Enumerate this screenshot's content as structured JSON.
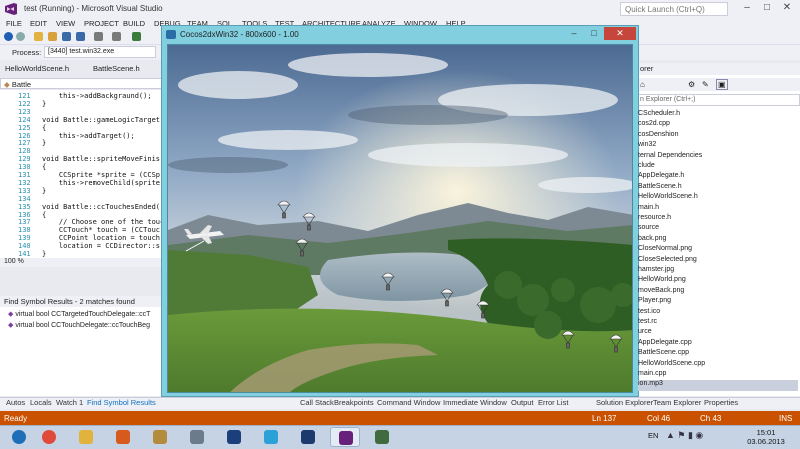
{
  "window": {
    "title": "test (Running) - Microsoft Visual Studio",
    "quick_launch": "Quick Launch (Ctrl+Q)",
    "minimize": "–",
    "maximize": "□",
    "close": "✕"
  },
  "menu": [
    "FILE",
    "EDIT",
    "VIEW",
    "PROJECT",
    "BUILD",
    "DEBUG",
    "TEAM",
    "SQL",
    "TOOLS",
    "TEST",
    "ARCHITECTURE",
    "ANALYZE",
    "WINDOW",
    "HELP"
  ],
  "process": {
    "label": "Process:",
    "value": "[3440] test.win32.exe"
  },
  "doc_tabs": [
    "HelloWorldScene.h",
    "BattleScene.h"
  ],
  "breadcrumb": "Battle",
  "code": [
    {
      "ln": "121",
      "text": "    this->addBackgraund();"
    },
    {
      "ln": "122",
      "text": "}"
    },
    {
      "ln": "123",
      "text": ""
    },
    {
      "ln": "124",
      "text": "void Battle::gameLogicTarget"
    },
    {
      "ln": "125",
      "text": "{"
    },
    {
      "ln": "126",
      "text": "    this->addTarget();"
    },
    {
      "ln": "127",
      "text": "}"
    },
    {
      "ln": "128",
      "text": ""
    },
    {
      "ln": "129",
      "text": "void Battle::spriteMoveFinis"
    },
    {
      "ln": "130",
      "text": "{"
    },
    {
      "ln": "131",
      "text": "    CCSprite *sprite = (CCSp"
    },
    {
      "ln": "132",
      "text": "    this->removeChild(sprite"
    },
    {
      "ln": "133",
      "text": "}"
    },
    {
      "ln": "134",
      "text": ""
    },
    {
      "ln": "135",
      "text": "void Battle::ccTouchesEnded("
    },
    {
      "ln": "136",
      "text": "{"
    },
    {
      "ln": "137",
      "text": "    // Choose one of the touc"
    },
    {
      "ln": "138",
      "text": "    CCTouch* touch = (CCTouc"
    },
    {
      "ln": "139",
      "text": "    CCPoint location = touch"
    },
    {
      "ln": "140",
      "text": "    location = CCDirector::s"
    },
    {
      "ln": "141",
      "text": "}"
    }
  ],
  "zoom": "100 %",
  "find_results": {
    "header": "Find Symbol Results - 2 matches found",
    "items": [
      "virtual bool CCTargetedTouchDelegate::ccT",
      "virtual bool CCTouchDelegate::ccTouchBeg"
    ]
  },
  "bottom_tabs_left": [
    "Autos",
    "Locals",
    "Watch 1",
    "Find Symbol Results"
  ],
  "bottom_tabs_mid": [
    "Call Stack",
    "Breakpoints",
    "Command Window",
    "Immediate Window",
    "Output",
    "Error List"
  ],
  "bottom_tabs_right": [
    "Solution Explorer",
    "Team Explorer",
    "Properties"
  ],
  "status": {
    "ready": "Ready",
    "ln": "Ln 137",
    "col": "Col 46",
    "ch": "Ch 43",
    "mode": "INS"
  },
  "solution": {
    "header": "orer",
    "search": "n Explorer (Ctrl+;)",
    "items": [
      "CScheduler.h",
      "cos2d.cpp",
      "cosDenshion",
      "win32",
      "ternal Dependencies",
      "clude",
      "AppDelegate.h",
      "BattleScene.h",
      "HelloWorldScene.h",
      "main.h",
      "resource.h",
      "source",
      "back.png",
      "CloseNormal.png",
      "CloseSelected.png",
      "hamster.jpg",
      "HelloWorld.png",
      "moveBack.png",
      "Player.png",
      "test.ico",
      "test.rc",
      "urce",
      "AppDelegate.cpp",
      "BattleScene.cpp",
      "HelloWorldScene.cpp",
      "main.cpp",
      "ion.mp3"
    ]
  },
  "game": {
    "title": "Cocos2dxWin32 - 800x600 - 1.00"
  },
  "tray": {
    "lang": "EN",
    "time": "15:01",
    "date": "03.06.2013"
  },
  "taskbar_apps": [
    "start-orb",
    "chrome-icon",
    "explorer-icon",
    "media-icon",
    "paint-icon",
    "calculator-icon",
    "powershell-icon",
    "skype-icon",
    "photoshop-icon",
    "visual-studio-icon",
    "app-window-icon"
  ]
}
